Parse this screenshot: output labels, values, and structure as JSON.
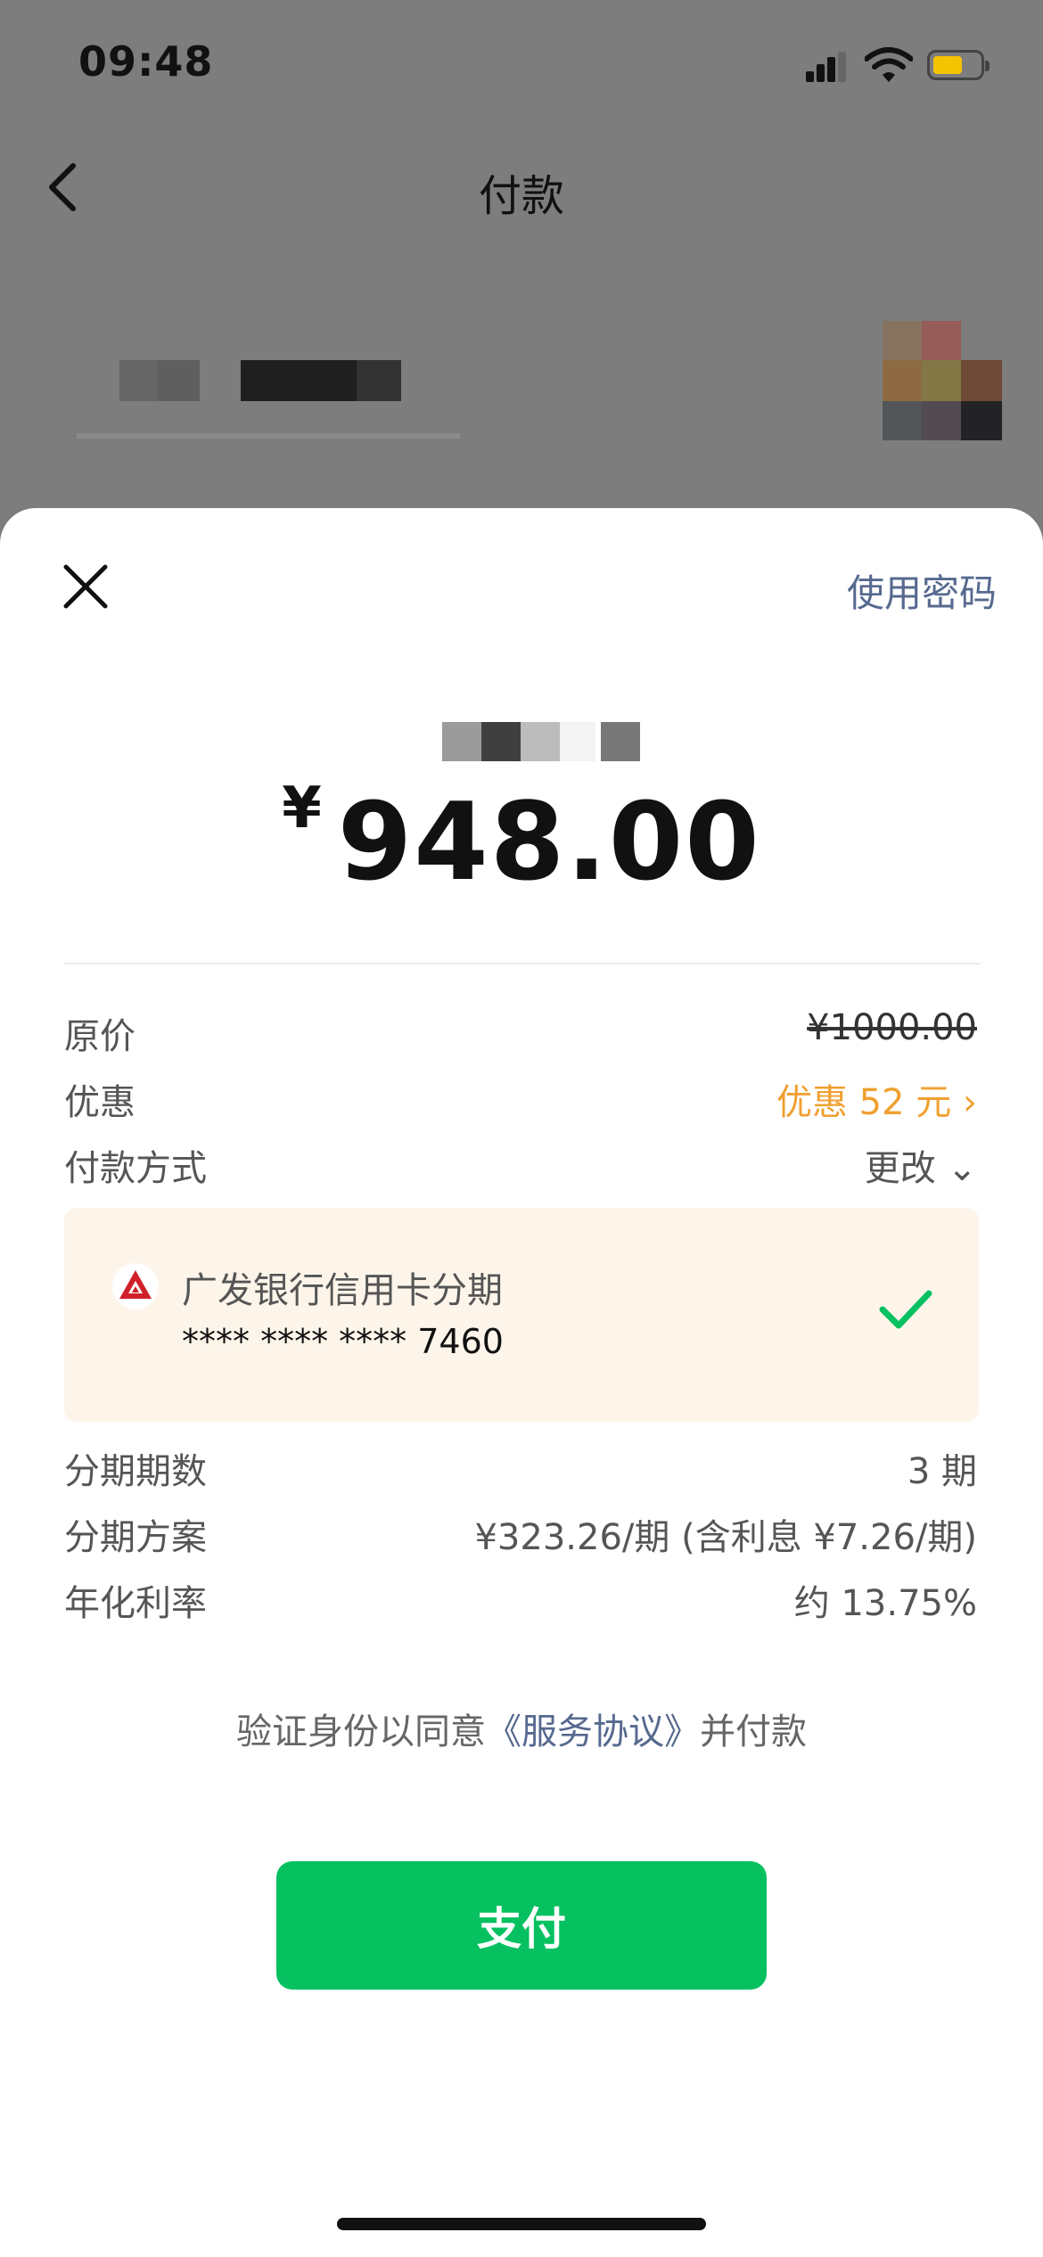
{
  "status_bar": {
    "time": "09:48"
  },
  "nav": {
    "title": "付款"
  },
  "sheet": {
    "use_password": "使用密码",
    "amount": {
      "currency": "¥",
      "value": "948.00"
    },
    "rows": {
      "original_price": {
        "label": "原价",
        "value": "¥1000.00"
      },
      "discount": {
        "label": "优惠",
        "value": "优惠 52 元 ›"
      },
      "payment_method": {
        "label": "付款方式",
        "value": "更改 ⌄"
      },
      "installments": {
        "label": "分期期数",
        "value": "3 期"
      },
      "plan": {
        "label": "分期方案",
        "value": "¥323.26/期 (含利息 ¥7.26/期)"
      },
      "apr": {
        "label": "年化利率",
        "value": "约 13.75%"
      }
    },
    "method_card": {
      "bank_name": "广发银行信用卡分期",
      "card_number": "**** **** **** 7460",
      "bank_icon": "cgb-bank-logo-icon",
      "check_icon": "checkmark-icon"
    },
    "agreement": {
      "prefix": "验证身份以同意",
      "link": "《服务协议》",
      "suffix": "并付款"
    },
    "pay_button": "支付"
  },
  "colors": {
    "accent_green": "#07c160",
    "link_blue": "#56698f",
    "discount_orange": "#f0a030",
    "card_bg": "#fdf5ea"
  }
}
